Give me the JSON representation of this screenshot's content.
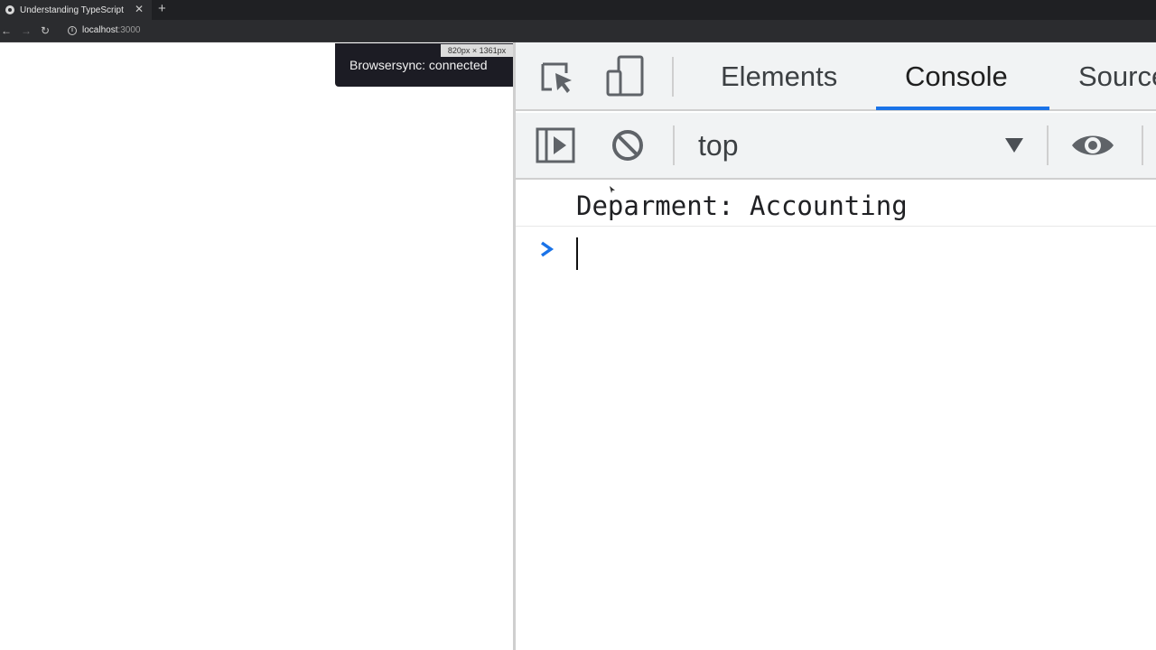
{
  "browser": {
    "tab_title": "Understanding TypeScript",
    "tab_close": "✕",
    "new_tab": "+",
    "nav_back": "←",
    "nav_forward": "→",
    "nav_reload": "↻",
    "url_host": "localhost",
    "url_port": ":3000"
  },
  "page": {
    "viewport_size": "820px × 1361px",
    "browsersync_notice": "Browsersync: connected"
  },
  "devtools": {
    "tabs": [
      {
        "label": "Elements"
      },
      {
        "label": "Console",
        "active": true
      },
      {
        "label": "Sources"
      }
    ],
    "context": "top",
    "console": {
      "log_messages": [
        "Deparment: Accounting"
      ],
      "prompt_symbol": ">"
    },
    "colors": {
      "accent": "#1a73e8",
      "toolbar_bg": "#f1f3f4"
    }
  }
}
